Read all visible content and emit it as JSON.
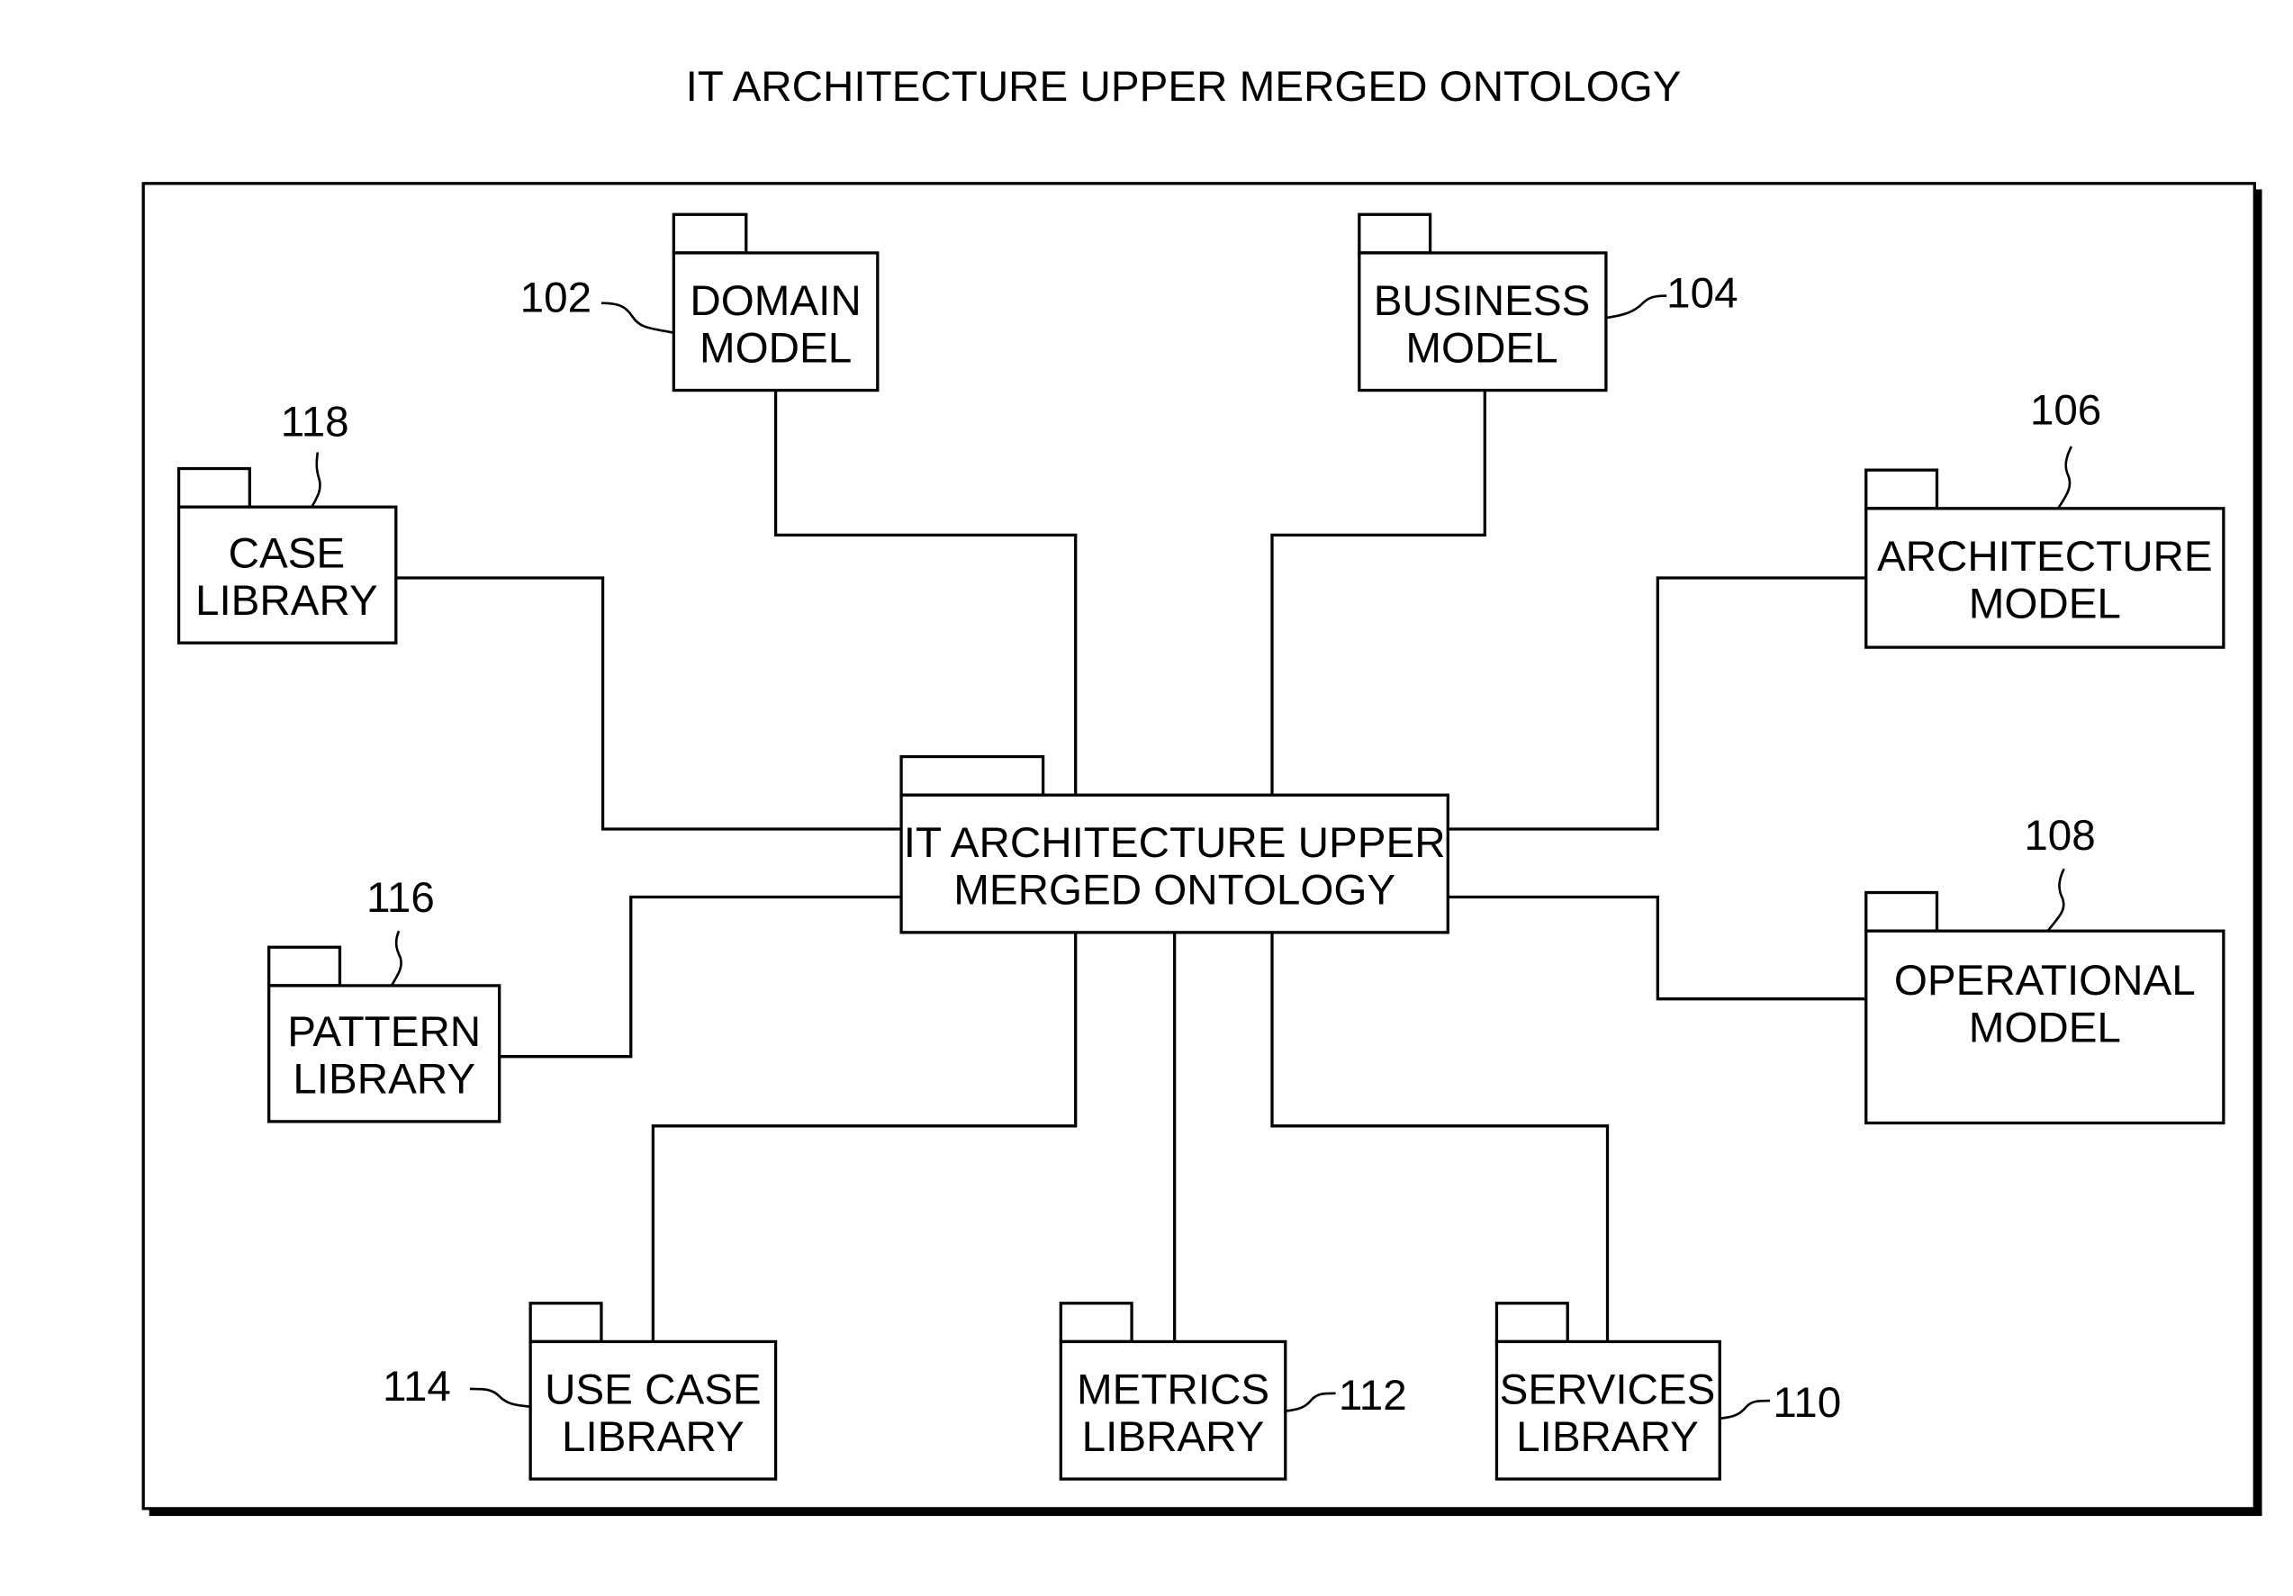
{
  "diagram": {
    "title": "IT ARCHITECTURE UPPER MERGED ONTOLOGY",
    "center": {
      "line1": "IT ARCHITECTURE UPPER",
      "line2": "MERGED ONTOLOGY"
    },
    "nodes": [
      {
        "id": "domain-model",
        "ref": "102",
        "line1": "DOMAIN",
        "line2": "MODEL"
      },
      {
        "id": "business-model",
        "ref": "104",
        "line1": "BUSINESS",
        "line2": "MODEL"
      },
      {
        "id": "architecture-model",
        "ref": "106",
        "line1": "ARCHITECTURE",
        "line2": "MODEL"
      },
      {
        "id": "operational-model",
        "ref": "108",
        "line1": "OPERATIONAL",
        "line2": "MODEL"
      },
      {
        "id": "services-library",
        "ref": "110",
        "line1": "SERVICES",
        "line2": "LIBRARY"
      },
      {
        "id": "metrics-library",
        "ref": "112",
        "line1": "METRICS",
        "line2": "LIBRARY"
      },
      {
        "id": "use-case-library",
        "ref": "114",
        "line1": "USE CASE",
        "line2": "LIBRARY"
      },
      {
        "id": "pattern-library",
        "ref": "116",
        "line1": "PATTERN",
        "line2": "LIBRARY"
      },
      {
        "id": "case-library",
        "ref": "118",
        "line1": "CASE",
        "line2": "LIBRARY"
      }
    ]
  }
}
